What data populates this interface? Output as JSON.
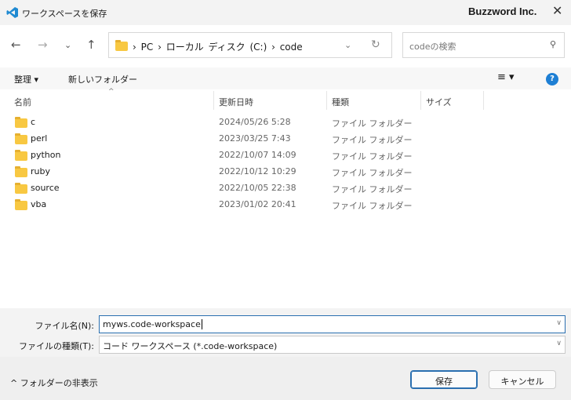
{
  "window": {
    "title": "ワークスペースを保存",
    "brand": "Buzzword Inc."
  },
  "address": {
    "crumbs": [
      "PC",
      "ローカル ディスク (C:)",
      "code"
    ]
  },
  "search": {
    "placeholder": "codeの検索"
  },
  "toolbar": {
    "organize": "整理",
    "new_folder": "新しいフォルダー"
  },
  "columns": {
    "name": "名前",
    "modified": "更新日時",
    "type": "種類",
    "size": "サイズ"
  },
  "files": [
    {
      "name": "c",
      "modified": "2024/05/26 5:28",
      "type": "ファイル フォルダー"
    },
    {
      "name": "perl",
      "modified": "2023/03/25 7:43",
      "type": "ファイル フォルダー"
    },
    {
      "name": "python",
      "modified": "2022/10/07 14:09",
      "type": "ファイル フォルダー"
    },
    {
      "name": "ruby",
      "modified": "2022/10/12 10:29",
      "type": "ファイル フォルダー"
    },
    {
      "name": "source",
      "modified": "2022/10/05 22:38",
      "type": "ファイル フォルダー"
    },
    {
      "name": "vba",
      "modified": "2023/01/02 20:41",
      "type": "ファイル フォルダー"
    }
  ],
  "form": {
    "filename_label": "ファイル名(N):",
    "filename_value": "myws.code-workspace",
    "filetype_label": "ファイルの種類(T):",
    "filetype_value": "コード ワークスペース (*.code-workspace)"
  },
  "footer": {
    "hide_folders": "フォルダーの非表示",
    "save": "保存",
    "cancel": "キャンセル"
  }
}
